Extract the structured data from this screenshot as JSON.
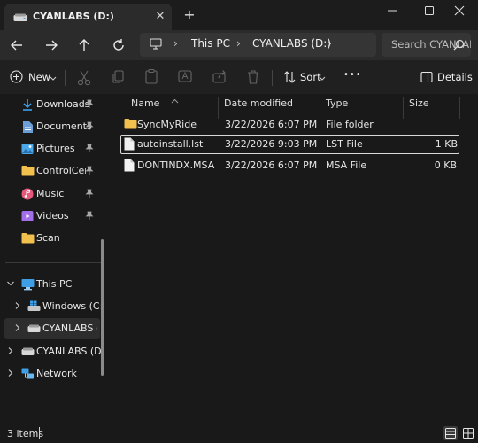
{
  "window": {
    "tab_title": "CYANLABS (D:)",
    "close_tab_glyph": "✕",
    "new_tab_glyph": "+"
  },
  "address": {
    "segments": [
      "This PC",
      "CYANLABS (D:)"
    ],
    "separator": "›"
  },
  "search": {
    "placeholder": "Search CYANLABS (D:)"
  },
  "toolbar": {
    "new_label": "New",
    "sort_label": "Sort",
    "more_glyph": "•••",
    "details_label": "Details"
  },
  "sidebar": {
    "quick_access": [
      {
        "label": "Downloads",
        "icon": "downloads-icon",
        "color": "#3aa0f0"
      },
      {
        "label": "Documents",
        "icon": "documents-icon",
        "color": "#6c9ed8"
      },
      {
        "label": "Pictures",
        "icon": "pictures-icon",
        "color": "#4aa8e8"
      },
      {
        "label": "ControlCenter",
        "icon": "folder-icon",
        "color": "#f2c04d"
      },
      {
        "label": "Music",
        "icon": "music-icon",
        "color": "#e8587a"
      },
      {
        "label": "Videos",
        "icon": "videos-icon",
        "color": "#a36ee8"
      },
      {
        "label": "Scan",
        "icon": "folder-icon",
        "color": "#f2c04d"
      }
    ],
    "this_pc": "This PC",
    "drives": [
      {
        "label": "Windows (C:)",
        "icon": "windows-drive-icon"
      },
      {
        "label": "CYANLABS (D:)",
        "icon": "drive-icon"
      }
    ],
    "removable": "CYANLABS (D:)",
    "network": "Network"
  },
  "columns": [
    "Name",
    "Date modified",
    "Type",
    "Size"
  ],
  "files": [
    {
      "name": "SyncMyRide",
      "date": "3/22/2026 6:07 PM",
      "type": "File folder",
      "size": "",
      "icon": "folder-icon",
      "selected": false
    },
    {
      "name": "autoinstall.lst",
      "date": "3/22/2026 9:03 PM",
      "type": "LST File",
      "size": "1 KB",
      "icon": "file-icon",
      "selected": true
    },
    {
      "name": "DONTINDX.MSA",
      "date": "3/22/2026 6:07 PM",
      "type": "MSA File",
      "size": "0 KB",
      "icon": "file-icon",
      "selected": false
    }
  ],
  "status": {
    "items_text": "3 items"
  },
  "colors": {
    "folder": "#f2c04d",
    "accent": "#3aa0f0",
    "pc_blue": "#3f9fe6"
  }
}
